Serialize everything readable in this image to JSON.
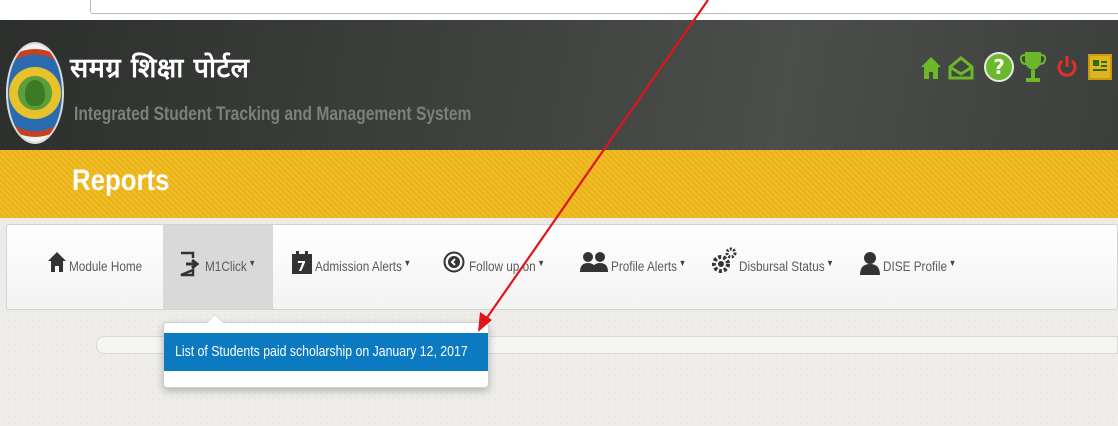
{
  "header": {
    "title_hindi": "समग्र शिक्षा पोर्टल",
    "subtitle": "Integrated Student Tracking and Management System",
    "icons": [
      "home-icon",
      "mail-open-icon",
      "help-icon",
      "trophy-icon",
      "power-icon",
      "id-card-icon"
    ],
    "help_glyph": "?"
  },
  "band": {
    "title": "Reports"
  },
  "nav": {
    "items": [
      {
        "label": "Module Home",
        "icon": "home-icon",
        "has_caret": false
      },
      {
        "label": "M1Click",
        "icon": "sign-out-icon",
        "has_caret": true
      },
      {
        "label": "Admission Alerts",
        "icon": "calendar-icon",
        "has_caret": true
      },
      {
        "label": "Follow up on",
        "icon": "circle-arrow-icon",
        "has_caret": true
      },
      {
        "label": "Profile Alerts",
        "icon": "users-icon",
        "has_caret": true
      },
      {
        "label": "Disbursal Status",
        "icon": "gears-icon",
        "has_caret": true
      },
      {
        "label": "DISE Profile",
        "icon": "user-icon",
        "has_caret": true
      }
    ],
    "caret": "▼"
  },
  "dropdown": {
    "items": [
      {
        "label": "List of Students paid scholarship on January 12, 2017"
      }
    ]
  },
  "colors": {
    "header_dark": "#3f423f",
    "band_yellow": "#f0b81a",
    "dropdown_blue": "#0b7ac0",
    "arrow_red": "#e0141b",
    "icon_green": "#6cb82b",
    "power_red": "#e0302a"
  }
}
